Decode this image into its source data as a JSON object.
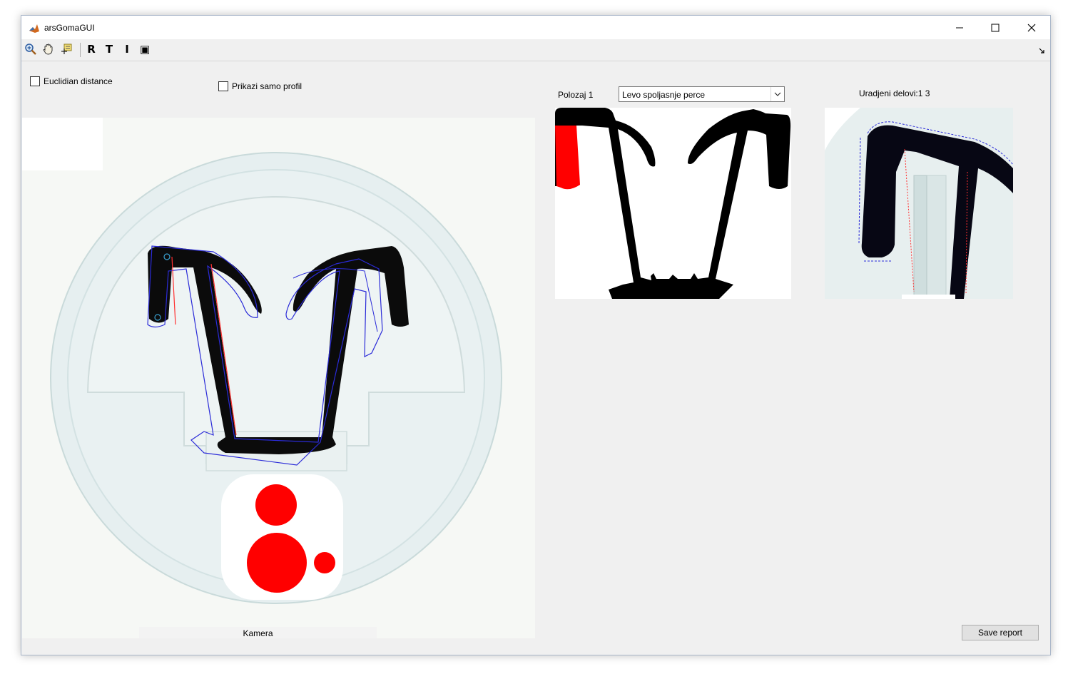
{
  "window": {
    "title": "arsGomaGUI",
    "icon": "matlab-logo-icon",
    "controls": [
      "minimize-icon",
      "maximize-icon",
      "close-icon"
    ]
  },
  "toolbar": {
    "tools": [
      "zoom-in-icon",
      "pan-hand-icon",
      "data-cursor-icon"
    ],
    "letters": [
      "R",
      "T",
      "I",
      "▣"
    ]
  },
  "controls": {
    "euclidian_label": "Euclidian distance",
    "euclidian_checked": false,
    "profil_label": "Prikazi samo profil",
    "profil_checked": false,
    "polozaj_label": "Polozaj 1",
    "polozaj_selected": "Levo spoljasnje perce",
    "uradjeni_label": "Uradjeni delovi:1  3"
  },
  "camera": {
    "label": "Kamera"
  },
  "buttons": {
    "save_report": "Save report"
  },
  "colors": {
    "accent_red": "#ff0000",
    "outline_blue": "#2b2bd8",
    "profile_black": "#000000"
  }
}
